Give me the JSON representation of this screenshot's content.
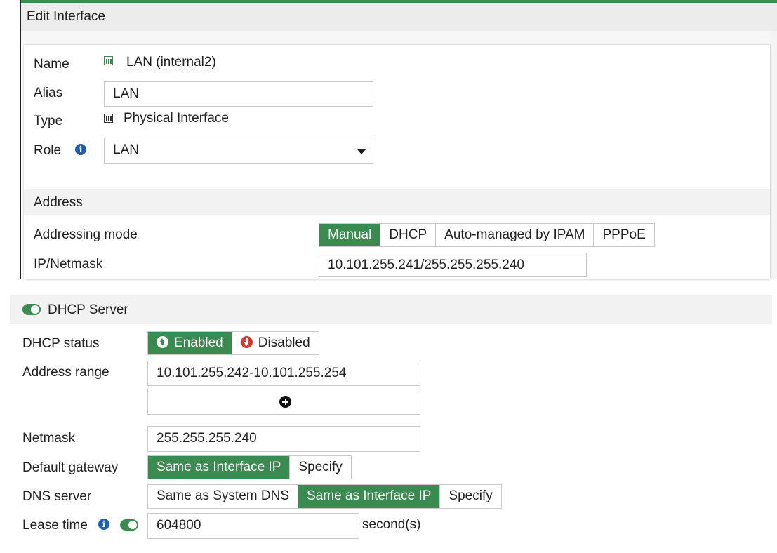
{
  "header": {
    "title": "Edit Interface"
  },
  "interface": {
    "name_label": "Name",
    "name_value": "LAN (internal2)",
    "alias_label": "Alias",
    "alias_value": "LAN",
    "type_label": "Type",
    "type_value": "Physical Interface",
    "role_label": "Role",
    "role_value": "LAN"
  },
  "address": {
    "section_title": "Address",
    "mode_label": "Addressing mode",
    "modes": [
      "Manual",
      "DHCP",
      "Auto-managed by IPAM",
      "PPPoE"
    ],
    "active_mode": "Manual",
    "ip_label": "IP/Netmask",
    "ip_value": "10.101.255.241/255.255.255.240"
  },
  "dhcp": {
    "section_title": "DHCP Server",
    "status_label": "DHCP status",
    "status_options": [
      "Enabled",
      "Disabled"
    ],
    "status_active": "Enabled",
    "range_label": "Address range",
    "range_value": "10.101.255.242-10.101.255.254",
    "netmask_label": "Netmask",
    "netmask_value": "255.255.255.240",
    "gateway_label": "Default gateway",
    "gateway_options": [
      "Same as Interface IP",
      "Specify"
    ],
    "gateway_active": "Same as Interface IP",
    "dns_label": "DNS server",
    "dns_options": [
      "Same as System DNS",
      "Same as Interface IP",
      "Specify"
    ],
    "dns_active": "Same as Interface IP",
    "lease_label": "Lease time",
    "lease_value": "604800",
    "lease_unit": "second(s)"
  },
  "colors": {
    "accent": "#3a8b50",
    "info": "#1e5fb0",
    "disabled": "#d23b2f"
  }
}
